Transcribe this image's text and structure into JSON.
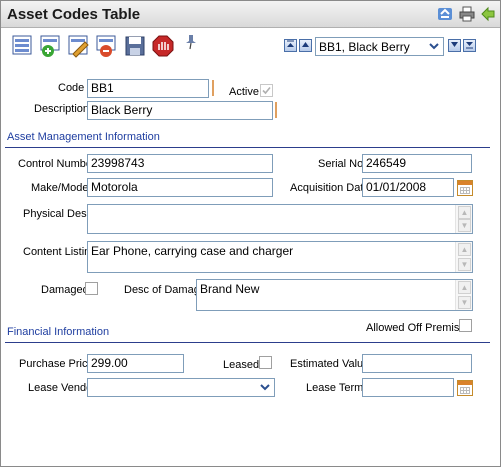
{
  "window": {
    "title": "Asset Codes Table"
  },
  "toolbar": {
    "icons": [
      "list-view-icon",
      "add-record-icon",
      "edit-record-icon",
      "delete-record-icon",
      "save-icon",
      "cancel-icon",
      "pin-icon"
    ]
  },
  "navigator": {
    "selected": "BB1, Black Berry"
  },
  "header_fields": {
    "code_label": "Code",
    "code_value": "BB1",
    "active_label": "Active",
    "description_label": "Description",
    "description_value": "Black Berry"
  },
  "asset_section": {
    "title": "Asset Management Information",
    "control_number_label": "Control Number",
    "control_number_value": "23998743",
    "serial_no_label": "Serial No",
    "serial_no_value": "246549",
    "make_model_label": "Make/Model",
    "make_model_value": "Motorola",
    "acquisition_date_label": "Acquisition Date",
    "acquisition_date_value": "01/01/2008",
    "physical_desc_label": "Physical Desc",
    "physical_desc_value": "",
    "content_listing_label": "Content Listing",
    "content_listing_value": "Ear Phone, carrying case and charger",
    "damaged_label": "Damaged",
    "desc_of_damage_label": "Desc of Damage",
    "desc_of_damage_value": "Brand New"
  },
  "financial_section": {
    "title": "Financial Information",
    "allowed_off_premises_label": "Allowed Off Premises",
    "purchase_price_label": "Purchase Price",
    "purchase_price_value": "299.00",
    "leased_label": "Leased",
    "estimated_value_label": "Estimated Value",
    "estimated_value_value": "",
    "lease_vendor_label": "Lease Vendor",
    "lease_vendor_value": "",
    "lease_term_label": "Lease Term",
    "lease_term_value": ""
  },
  "colors": {
    "section_title": "#1f3ea0",
    "section_rule": "#2c3e8c",
    "input_border": "#7f9db9",
    "required_marker": "#e0a060"
  }
}
